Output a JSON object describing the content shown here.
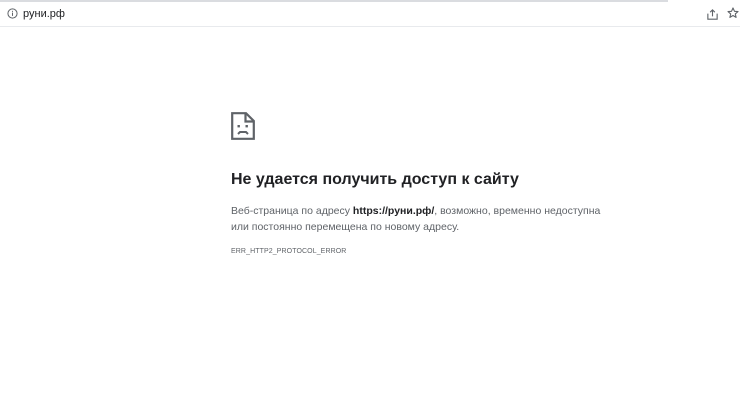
{
  "address_bar": {
    "url": "руни.рф",
    "info_icon": "info-circle-icon",
    "share_icon": "share-icon",
    "bookmark_icon": "star-icon"
  },
  "error_page": {
    "icon": "sad-page-icon",
    "title": "Не удается получить доступ к сайту",
    "desc_before": "Веб-страница по адресу ",
    "desc_url": "https://руни.рф/",
    "desc_after": ", возможно, временно недоступна или постоянно перемещена по новому адресу.",
    "error_code": "ERR_HTTP2_PROTOCOL_ERROR"
  },
  "colors": {
    "title": "#202124",
    "body_text": "#5f6368",
    "icon": "#5f6368",
    "background": "#ffffff"
  }
}
